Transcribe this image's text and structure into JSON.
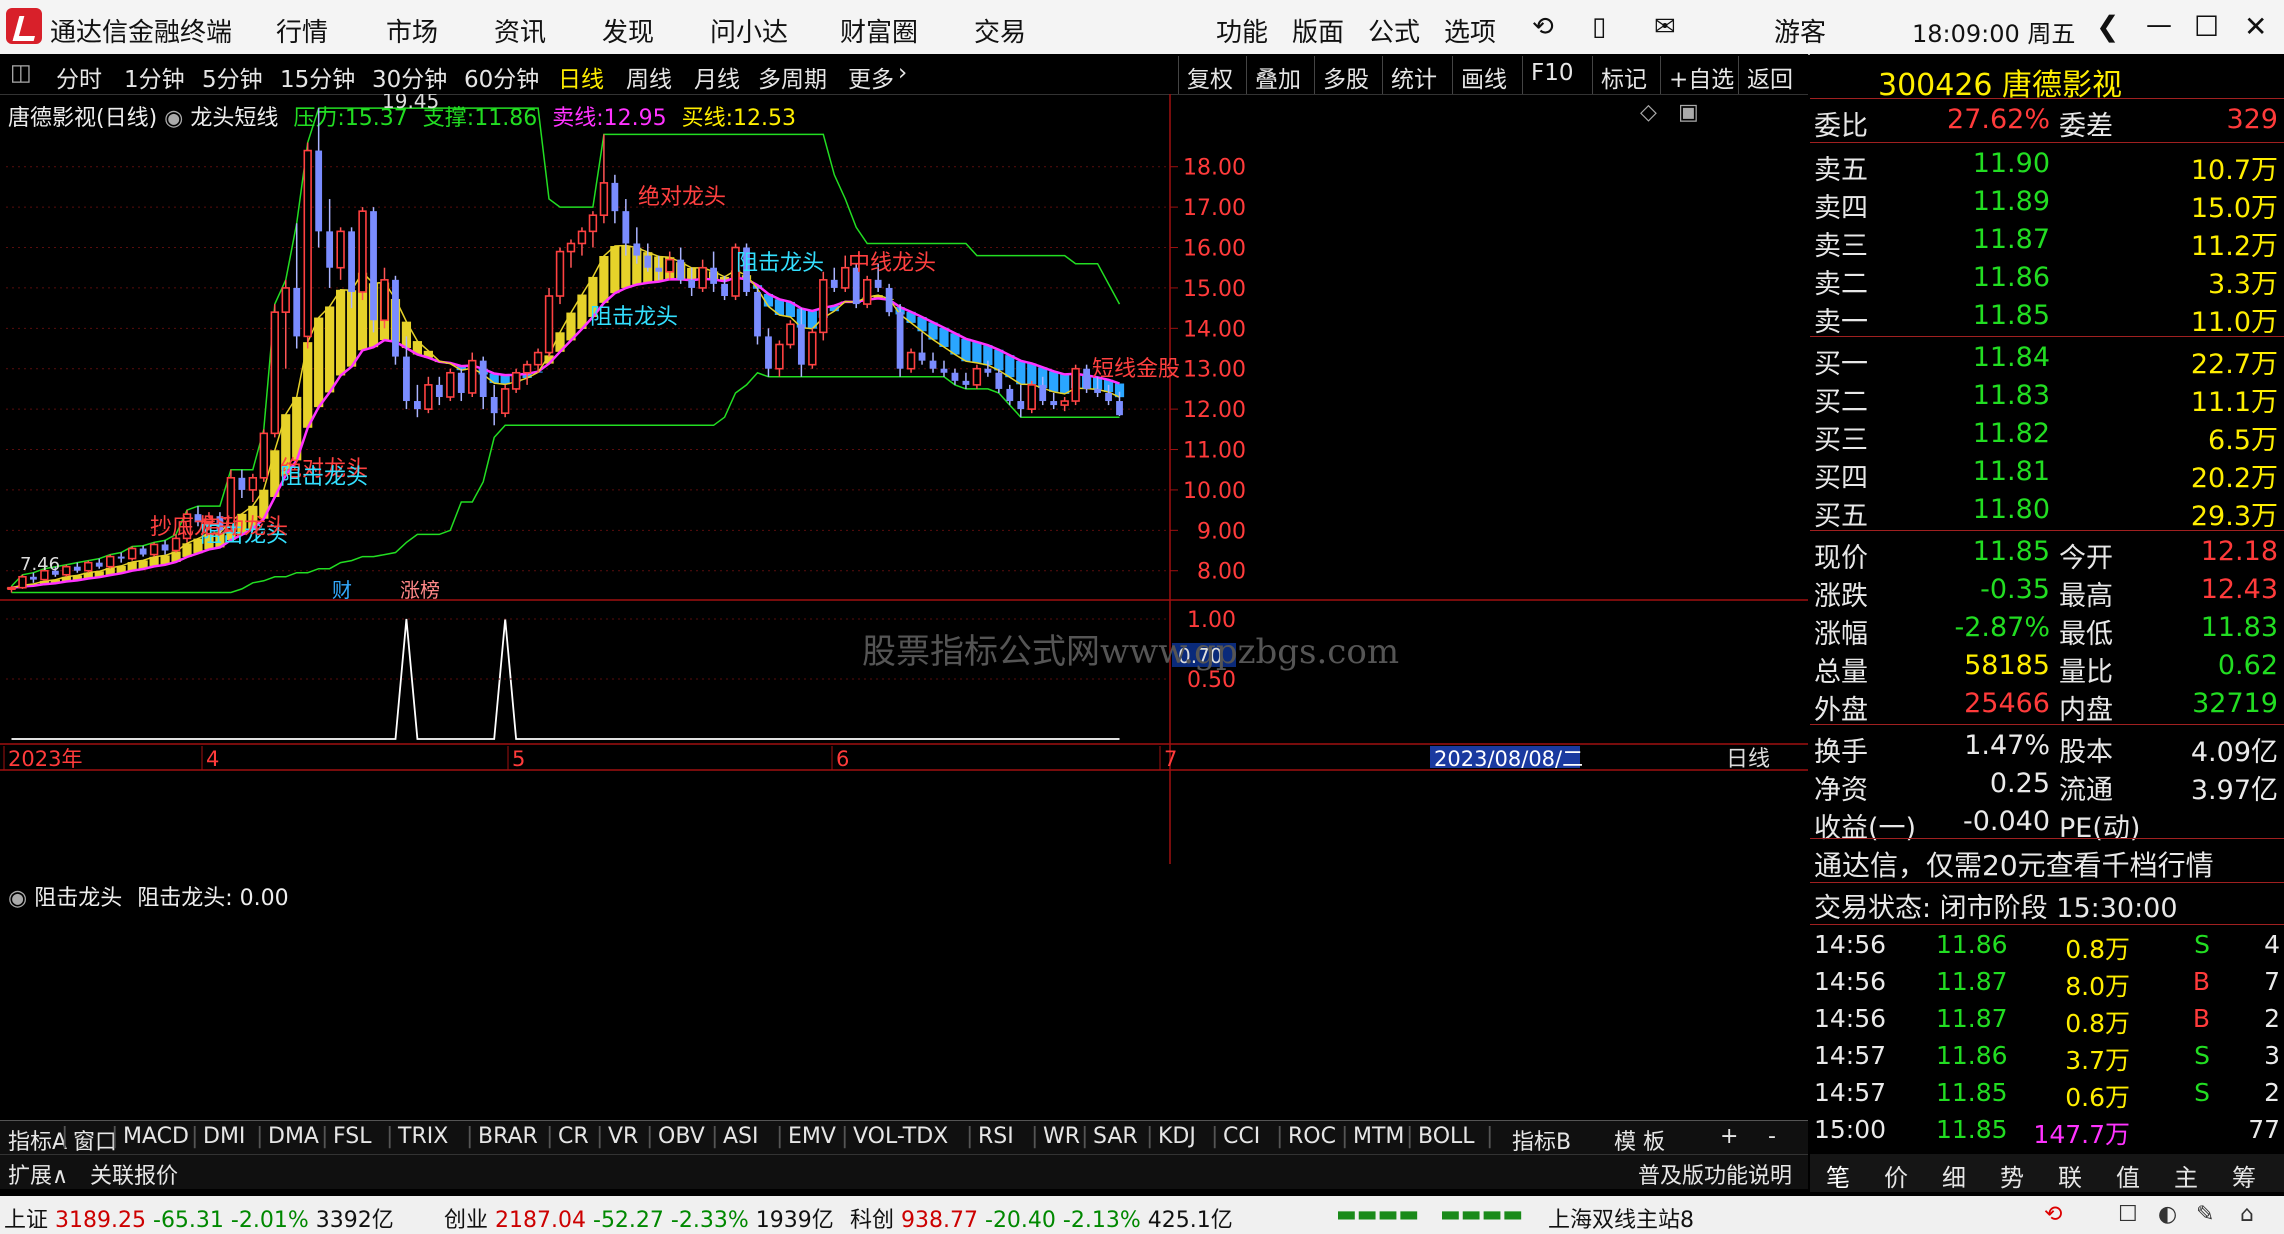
{
  "app": {
    "title": "通达信金融终端",
    "menu": [
      "行情",
      "市场",
      "资讯",
      "发现",
      "问小达",
      "财富圈",
      "交易"
    ],
    "right_menu": [
      "功能",
      "版面",
      "公式",
      "选项"
    ],
    "user": "游客",
    "clock": "18:09:00 周五"
  },
  "toolbar": {
    "periods": [
      "分时",
      "1分钟",
      "5分钟",
      "15分钟",
      "30分钟",
      "60分钟",
      "日线",
      "周线",
      "月线",
      "多周期",
      "更多"
    ],
    "active": "日线",
    "buttons": [
      "复权",
      "叠加",
      "多股",
      "统计",
      "画线",
      "F10",
      "标记",
      "+自选",
      "返回"
    ]
  },
  "chart_info": {
    "name": "唐德影视(日线)",
    "indicator": "龙头短线",
    "pressure_label": "压力:",
    "pressure": "15.37",
    "support_label": "支撑:",
    "support": "11.86",
    "sell_label": "卖线:",
    "sell": "12.95",
    "buy_label": "买线:",
    "buy": "12.53",
    "max_label": "19.45",
    "min_label": "7.46"
  },
  "chart_data": {
    "type": "candlestick",
    "y_ticks": [
      "18.00",
      "17.00",
      "16.00",
      "15.00",
      "14.00",
      "13.00",
      "12.00",
      "11.00",
      "10.00",
      "9.00",
      "8.00"
    ],
    "ylim": [
      7.3,
      19.8
    ],
    "x_labels": [
      "2023年",
      "4",
      "5",
      "6",
      "7",
      "2023/08/08/二"
    ],
    "annotations": [
      "绝对龙头",
      "阻击龙头",
      "阻击龙头",
      "抄底龙头",
      "绝对龙头",
      "阻击龙头",
      "中线龙头",
      "短线金股",
      "阻击龙头",
      "启动龙头"
    ],
    "event_tags": [
      "财",
      "涨榜"
    ],
    "watermark": "股票指标公式网www.gpzbgs.com",
    "candles": [
      [
        7.55,
        7.62,
        7.46,
        7.58
      ],
      [
        7.58,
        7.9,
        7.55,
        7.85
      ],
      [
        7.85,
        7.95,
        7.7,
        7.78
      ],
      [
        7.78,
        8.05,
        7.75,
        8.0
      ],
      [
        8.0,
        8.1,
        7.85,
        7.9
      ],
      [
        7.9,
        8.15,
        7.85,
        8.1
      ],
      [
        8.1,
        8.2,
        7.95,
        8.0
      ],
      [
        8.0,
        8.25,
        7.95,
        8.2
      ],
      [
        8.2,
        8.3,
        8.05,
        8.1
      ],
      [
        8.1,
        8.4,
        8.05,
        8.35
      ],
      [
        8.35,
        8.45,
        8.2,
        8.3
      ],
      [
        8.3,
        8.6,
        8.25,
        8.55
      ],
      [
        8.55,
        8.62,
        8.35,
        8.4
      ],
      [
        8.4,
        8.7,
        8.35,
        8.65
      ],
      [
        8.65,
        8.75,
        8.4,
        8.5
      ],
      [
        8.5,
        8.9,
        8.45,
        8.8
      ],
      [
        8.8,
        9.5,
        8.7,
        9.4
      ],
      [
        9.4,
        9.6,
        9.1,
        9.2
      ],
      [
        9.2,
        9.45,
        9.0,
        9.35
      ],
      [
        9.35,
        9.45,
        8.9,
        9.0
      ],
      [
        9.0,
        10.5,
        9.0,
        10.3
      ],
      [
        10.3,
        10.5,
        9.8,
        10.0
      ],
      [
        10.0,
        10.4,
        9.7,
        10.3
      ],
      [
        10.3,
        11.5,
        10.2,
        11.4
      ],
      [
        11.4,
        14.6,
        11.3,
        14.4
      ],
      [
        14.4,
        15.2,
        13.0,
        15.0
      ],
      [
        15.0,
        16.6,
        13.5,
        13.8
      ],
      [
        13.8,
        18.6,
        13.5,
        18.4
      ],
      [
        18.4,
        19.45,
        16.0,
        16.4
      ],
      [
        16.4,
        17.2,
        15.0,
        15.5
      ],
      [
        15.5,
        16.5,
        15.2,
        16.4
      ],
      [
        16.4,
        16.5,
        14.5,
        14.9
      ],
      [
        14.9,
        17.0,
        14.7,
        16.9
      ],
      [
        16.9,
        17.0,
        13.9,
        14.2
      ],
      [
        14.2,
        15.5,
        14.0,
        15.2
      ],
      [
        15.2,
        15.3,
        13.1,
        13.3
      ],
      [
        13.3,
        13.8,
        12.0,
        12.2
      ],
      [
        12.2,
        12.6,
        11.8,
        12.0
      ],
      [
        12.0,
        12.8,
        11.9,
        12.6
      ],
      [
        12.6,
        12.8,
        12.1,
        12.3
      ],
      [
        12.3,
        13.0,
        12.2,
        12.9
      ],
      [
        12.9,
        13.0,
        12.2,
        12.4
      ],
      [
        12.4,
        13.4,
        12.3,
        13.2
      ],
      [
        13.2,
        13.3,
        12.0,
        12.3
      ],
      [
        12.3,
        12.6,
        11.6,
        11.9
      ],
      [
        11.9,
        12.6,
        11.8,
        12.5
      ],
      [
        12.5,
        13.0,
        12.4,
        12.9
      ],
      [
        12.9,
        13.2,
        12.6,
        13.1
      ],
      [
        13.1,
        13.5,
        12.9,
        13.4
      ],
      [
        13.4,
        15.0,
        13.3,
        14.8
      ],
      [
        14.8,
        16.0,
        14.6,
        15.9
      ],
      [
        15.9,
        16.2,
        15.5,
        16.1
      ],
      [
        16.1,
        16.5,
        15.8,
        16.4
      ],
      [
        16.4,
        16.9,
        16.0,
        16.8
      ],
      [
        16.8,
        18.8,
        16.6,
        17.6
      ],
      [
        17.6,
        17.8,
        16.6,
        16.9
      ],
      [
        16.9,
        17.2,
        15.8,
        16.1
      ],
      [
        16.1,
        16.5,
        15.6,
        15.8
      ],
      [
        15.8,
        16.1,
        15.4,
        15.5
      ],
      [
        15.5,
        15.8,
        15.2,
        15.4
      ],
      [
        15.4,
        15.9,
        15.2,
        15.7
      ],
      [
        15.7,
        16.0,
        15.1,
        15.2
      ],
      [
        15.2,
        15.5,
        14.8,
        15.0
      ],
      [
        15.0,
        15.7,
        14.9,
        15.5
      ],
      [
        15.5,
        15.9,
        14.9,
        15.1
      ],
      [
        15.1,
        15.3,
        14.7,
        14.8
      ],
      [
        14.8,
        16.1,
        14.7,
        16.0
      ],
      [
        16.0,
        16.1,
        14.8,
        14.9
      ],
      [
        14.9,
        15.0,
        13.6,
        13.8
      ],
      [
        13.8,
        14.0,
        12.8,
        13.0
      ],
      [
        13.0,
        13.7,
        12.8,
        13.6
      ],
      [
        13.6,
        14.2,
        13.5,
        14.1
      ],
      [
        14.1,
        14.5,
        12.8,
        13.1
      ],
      [
        13.1,
        14.0,
        13.0,
        13.9
      ],
      [
        13.9,
        15.4,
        13.7,
        15.2
      ],
      [
        15.2,
        15.5,
        14.9,
        15.0
      ],
      [
        15.0,
        15.8,
        14.9,
        15.5
      ],
      [
        15.5,
        15.6,
        14.5,
        14.6
      ],
      [
        14.6,
        15.3,
        14.5,
        15.2
      ],
      [
        15.2,
        15.6,
        14.9,
        15.0
      ],
      [
        15.0,
        15.1,
        14.3,
        14.4
      ],
      [
        14.4,
        14.6,
        12.8,
        13.0
      ],
      [
        13.0,
        13.5,
        12.9,
        13.4
      ],
      [
        13.4,
        13.9,
        13.1,
        13.2
      ],
      [
        13.2,
        13.4,
        12.9,
        13.0
      ],
      [
        13.0,
        13.2,
        12.8,
        12.9
      ],
      [
        12.9,
        13.0,
        12.6,
        12.7
      ],
      [
        12.7,
        12.9,
        12.5,
        12.6
      ],
      [
        12.6,
        13.1,
        12.5,
        13.0
      ],
      [
        13.0,
        13.2,
        12.8,
        12.9
      ],
      [
        12.9,
        13.0,
        12.4,
        12.5
      ],
      [
        12.5,
        12.6,
        12.1,
        12.2
      ],
      [
        12.2,
        12.6,
        11.8,
        12.0
      ],
      [
        12.0,
        12.7,
        11.9,
        12.6
      ],
      [
        12.6,
        12.8,
        12.1,
        12.2
      ],
      [
        12.2,
        12.4,
        12.0,
        12.1
      ],
      [
        12.1,
        12.3,
        11.95,
        12.2
      ],
      [
        12.2,
        13.1,
        12.1,
        13.0
      ],
      [
        13.0,
        13.1,
        12.4,
        12.5
      ],
      [
        12.5,
        12.8,
        12.3,
        12.4
      ],
      [
        12.4,
        12.6,
        12.1,
        12.2
      ],
      [
        12.2,
        12.43,
        11.83,
        11.85
      ]
    ]
  },
  "sub_chart": {
    "name": "阻击龙头",
    "label": "阻击龙头: 0.00",
    "ticks": [
      "1.00",
      "0.50"
    ],
    "cursor": "0.70",
    "period": "日线",
    "peaks": [
      36,
      45
    ]
  },
  "right_panel": {
    "header": "300426 唐德影视",
    "weibi": {
      "k": "委比",
      "v": "27.62%",
      "k2": "委差",
      "v2": "329"
    },
    "sells": [
      [
        "卖五",
        "11.90",
        "10.7万"
      ],
      [
        "卖四",
        "11.89",
        "15.0万"
      ],
      [
        "卖三",
        "11.87",
        "11.2万"
      ],
      [
        "卖二",
        "11.86",
        "3.3万"
      ],
      [
        "卖一",
        "11.85",
        "11.0万"
      ]
    ],
    "buys": [
      [
        "买一",
        "11.84",
        "22.7万"
      ],
      [
        "买二",
        "11.83",
        "11.1万"
      ],
      [
        "买三",
        "11.82",
        "6.5万"
      ],
      [
        "买四",
        "11.81",
        "20.2万"
      ],
      [
        "买五",
        "11.80",
        "29.3万"
      ]
    ],
    "stats": [
      [
        "现价",
        "11.85",
        "今开",
        "12.18"
      ],
      [
        "涨跌",
        "-0.35",
        "最高",
        "12.43"
      ],
      [
        "涨幅",
        "-2.87%",
        "最低",
        "11.83"
      ],
      [
        "总量",
        "58185",
        "量比",
        "0.62"
      ],
      [
        "外盘",
        "25466",
        "内盘",
        "32719"
      ]
    ],
    "stats2": [
      [
        "换手",
        "1.47%",
        "股本",
        "4.09亿"
      ],
      [
        "净资",
        "0.25",
        "流通",
        "3.97亿"
      ],
      [
        "收益(一)",
        "-0.040",
        "PE(动)",
        ""
      ]
    ],
    "promo": "通达信，仅需20元查看千档行情",
    "trade_state": "交易状态: 闭市阶段 15:30:00",
    "ticks": [
      [
        "14:56",
        "11.86",
        "0.8万",
        "S",
        "4"
      ],
      [
        "14:56",
        "11.87",
        "8.0万",
        "B",
        "7"
      ],
      [
        "14:56",
        "11.87",
        "0.8万",
        "B",
        "2"
      ],
      [
        "14:57",
        "11.86",
        "3.7万",
        "S",
        "3"
      ],
      [
        "14:57",
        "11.85",
        "0.6万",
        "S",
        "2"
      ],
      [
        "15:00",
        "11.85",
        "147.7万",
        "",
        "77"
      ]
    ]
  },
  "indicator_tabs": [
    "指标A",
    "窗口",
    "MACD",
    "DMI",
    "DMA",
    "FSL",
    "TRIX",
    "BRAR",
    "CR",
    "VR",
    "OBV",
    "ASI",
    "EMV",
    "VOL-TDX",
    "RSI",
    "WR",
    "SAR",
    "KDJ",
    "CCI",
    "ROC",
    "MTM",
    "BOLL"
  ],
  "indicator_right": [
    "指标B",
    "模 板",
    "+",
    "-"
  ],
  "row2": [
    "扩展∧",
    "关联报价"
  ],
  "row2_right": "普及版功能说明",
  "right_tabs": [
    "笔",
    "价",
    "细",
    "势",
    "联",
    "值",
    "主",
    "筹"
  ],
  "status": [
    [
      "上证",
      "3189.25",
      "-65.31",
      "-2.01%",
      "3392亿"
    ],
    [
      "创业",
      "2187.04",
      "-52.27",
      "-2.33%",
      "1939亿"
    ],
    [
      "科创",
      "938.77",
      "-20.40",
      "-2.13%",
      "425.1亿"
    ]
  ],
  "server": "上海双线主站8"
}
